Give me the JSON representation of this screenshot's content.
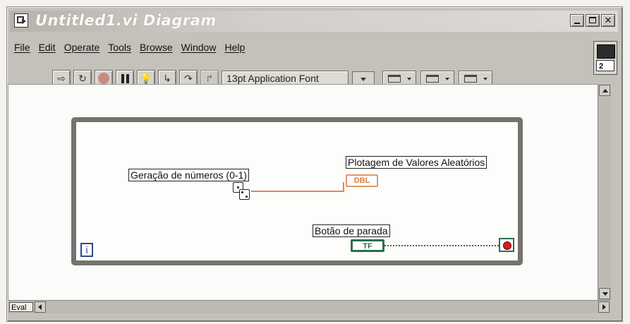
{
  "window": {
    "title": "Untitled1.vi Diagram",
    "controls": [
      "minimize",
      "maximize",
      "close"
    ]
  },
  "menubar": [
    "File",
    "Edit",
    "Operate",
    "Tools",
    "Browse",
    "Window",
    "Help"
  ],
  "toolbar": {
    "buttons": [
      "run-icon",
      "run-continuous-icon",
      "abort-icon",
      "pause-icon",
      "highlight-execution-icon",
      "step-into-icon",
      "step-over-icon",
      "step-out-icon"
    ],
    "font": "13pt Application Font"
  },
  "connector_pane": {
    "number": "2"
  },
  "diagram": {
    "random_label": "Geração de números (0-1)",
    "plot_label": "Plotagem de Valores Aleatórios",
    "plot_terminal": "DBL",
    "stop_label": "Botão de parada",
    "stop_terminal": "TF",
    "iteration": "i"
  },
  "statusbar": {
    "eval": "Eval"
  },
  "colors": {
    "numeric_wire": "#e0855a",
    "boolean_wire": "#2c6e52",
    "loop_border": "#757370"
  }
}
